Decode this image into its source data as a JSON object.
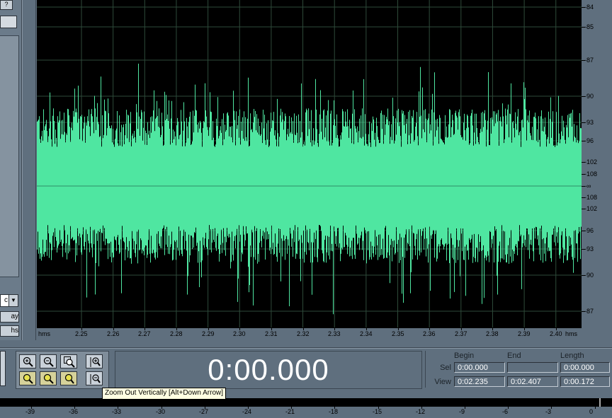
{
  "left_panel": {
    "help_label": "?",
    "dropdown_text": "c",
    "button_1_label": "ay",
    "button_2_label": "hs"
  },
  "waveform": {
    "color": "#4fe6a1",
    "background": "#000000",
    "grid_color": "#2e4a3a"
  },
  "db_scale": {
    "labels": [
      "-84",
      "-85",
      "-87",
      "-90",
      "-93",
      "-96",
      "-102",
      "-108",
      "-∞",
      "-108",
      "-102",
      "-96",
      "-93",
      "-90",
      "-87"
    ]
  },
  "time_ruler": {
    "unit_left": "hms",
    "unit_right": "hms",
    "ticks": [
      "2.25",
      "2.26",
      "2.27",
      "2.28",
      "2.29",
      "2.30",
      "2.31",
      "2.32",
      "2.33",
      "2.34",
      "2.35",
      "2.36",
      "2.37",
      "2.38",
      "2.39",
      "2.40"
    ]
  },
  "zoom_buttons": [
    {
      "name": "zoom-in-horizontal-button",
      "tooltip": "Zoom In"
    },
    {
      "name": "zoom-out-horizontal-button",
      "tooltip": "Zoom Out"
    },
    {
      "name": "zoom-full-button",
      "tooltip": "Zoom Out Full"
    },
    {
      "name": "zoom-in-vertical-button",
      "tooltip": "Zoom In Vertically"
    },
    {
      "name": "zoom-to-left-button",
      "tooltip": "Zoom to Left"
    },
    {
      "name": "zoom-to-right-button",
      "tooltip": "Zoom to Right"
    },
    {
      "name": "zoom-selection-button",
      "tooltip": "Zoom to Selection"
    },
    {
      "name": "zoom-out-vertical-button",
      "tooltip": "Zoom Out Vertically"
    }
  ],
  "time_display": {
    "value": "0:00.000"
  },
  "selection_panel": {
    "headers": {
      "begin": "Begin",
      "end": "End",
      "length": "Length"
    },
    "sel": {
      "label": "Sel",
      "begin": "0:00.000",
      "end": "",
      "length": "0:00.000"
    },
    "view": {
      "label": "View",
      "begin": "0:02.235",
      "end": "0:02.407",
      "length": "0:00.172"
    }
  },
  "tooltip": {
    "text": "Zoom Out Vertically    [Alt+Down Arrow]"
  },
  "level_meter": {
    "labels": [
      "-39",
      "-36",
      "-33",
      "-30",
      "-27",
      "-24",
      "-21",
      "-18",
      "-15",
      "-12",
      "-9",
      "-6",
      "-3",
      "0"
    ]
  }
}
